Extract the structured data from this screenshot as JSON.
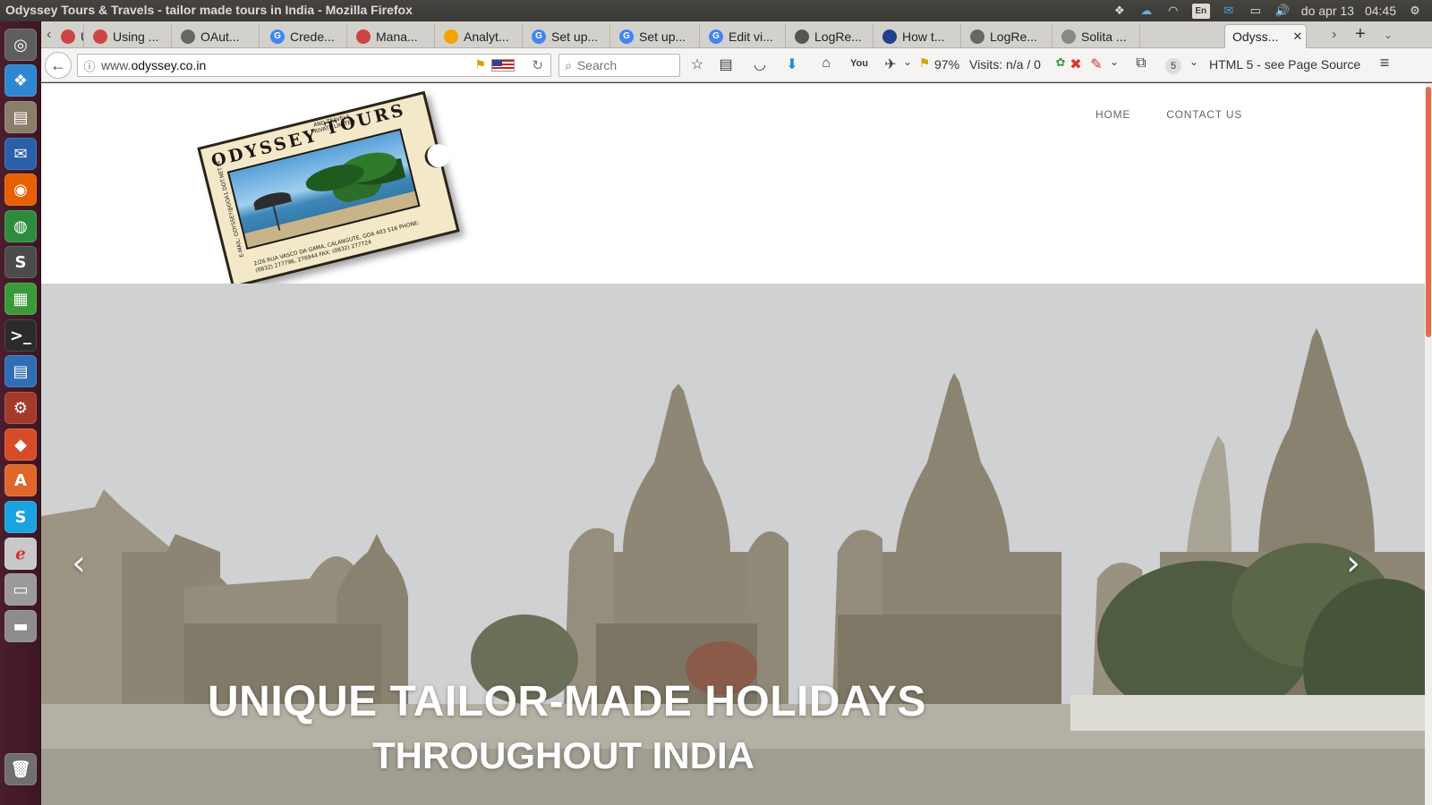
{
  "window": {
    "title": "Odyssey Tours & Travels - tailor made tours in India - Mozilla Firefox"
  },
  "tray": {
    "keyboard": "En",
    "date": "do apr 13",
    "time": "04:45"
  },
  "launcher": {
    "items": [
      {
        "icon": "ubuntu-dash-icon",
        "color": "#5e5e5e",
        "glyph": "◎"
      },
      {
        "icon": "dropbox-icon",
        "color": "#2f86d1",
        "glyph": "❖"
      },
      {
        "icon": "files-icon",
        "color": "#8a7d6a",
        "glyph": "▤"
      },
      {
        "icon": "thunderbird-icon",
        "color": "#2b5fa8",
        "glyph": "✉"
      },
      {
        "icon": "firefox-icon",
        "color": "#e66000",
        "glyph": "◉"
      },
      {
        "icon": "chrome-icon",
        "color": "#2e8b3e",
        "glyph": "◍"
      },
      {
        "icon": "sublime-text-icon",
        "color": "#4b4b4b",
        "glyph": "S"
      },
      {
        "icon": "spreadsheet-icon",
        "color": "#3a9a3a",
        "glyph": "▦"
      },
      {
        "icon": "terminal-icon",
        "color": "#2b2b2b",
        "glyph": ">_"
      },
      {
        "icon": "writer-icon",
        "color": "#2f6db5",
        "glyph": "▤"
      },
      {
        "icon": "settings-icon",
        "color": "#a33a2a",
        "glyph": "⚙"
      },
      {
        "icon": "git-icon",
        "color": "#d84b2a",
        "glyph": "◆"
      },
      {
        "icon": "software-center-icon",
        "color": "#e0672a",
        "glyph": "A"
      },
      {
        "icon": "skype-icon",
        "color": "#1aa3e0",
        "glyph": "S"
      },
      {
        "icon": "pdf-viewer-icon",
        "color": "#c8c8c8",
        "glyph": "ℯ"
      },
      {
        "icon": "scanner-icon",
        "color": "#9a9a9a",
        "glyph": "▭"
      },
      {
        "icon": "drive-icon",
        "color": "#8c8c8c",
        "glyph": "▬"
      },
      {
        "icon": "trash-icon",
        "color": "#6f6f6f",
        "glyph": "🗑"
      }
    ]
  },
  "tabs": [
    {
      "label": "Using ...",
      "icon": "generic-site-icon",
      "color": "#c44"
    },
    {
      "label": "Using ...",
      "icon": "generic-site-icon",
      "color": "#c44"
    },
    {
      "label": "OAut...",
      "icon": "oauth-icon",
      "color": "#666"
    },
    {
      "label": "Crede...",
      "icon": "google-icon",
      "color": "#4285f4"
    },
    {
      "label": "Mana...",
      "icon": "generic-site-icon",
      "color": "#c44"
    },
    {
      "label": "Analyt...",
      "icon": "analytics-icon",
      "color": "#f4a300"
    },
    {
      "label": "Set up...",
      "icon": "google-icon",
      "color": "#4285f4"
    },
    {
      "label": "Set up...",
      "icon": "google-icon",
      "color": "#4285f4"
    },
    {
      "label": "Edit vi...",
      "icon": "google-icon",
      "color": "#4285f4"
    },
    {
      "label": "LogRe...",
      "icon": "generic-site-icon",
      "color": "#555"
    },
    {
      "label": "How t...",
      "icon": "perl-icon",
      "color": "#1f3f8f"
    },
    {
      "label": "LogRe...",
      "icon": "generic-site-icon",
      "color": "#666"
    },
    {
      "label": "Solita ...",
      "icon": "solita-icon",
      "color": "#888"
    },
    {
      "label": "Odyss...",
      "icon": "odyssey-icon",
      "color": "#fff",
      "active": true
    }
  ],
  "navbar": {
    "url_prefix": "www.",
    "url_domain": "odyssey.co.in",
    "search_placeholder": "Search",
    "zoom": "97%",
    "visits": "Visits: n/a / 0",
    "addon_count": "5",
    "html_info": "HTML 5 - see Page Source"
  },
  "site": {
    "nav": {
      "home": "HOME",
      "contact": "CONTACT US"
    },
    "logo": {
      "word1": "ODYSSEY",
      "word2": "TOURS",
      "sub": "AND TRAVELS PRIVATE LIMITED",
      "address": "2/26 RUA VASCO DA GAMA, CALANGUTE, GOA 403 516 PHONE: (0832) 277796, 276944 FAX: (0832) 277724",
      "side": "E-MAIL: ODYSSEY@GOA1.DOT.NET.IN"
    },
    "hero": {
      "line1": "UNIQUE TAILOR-MADE HOLIDAYS",
      "line2": "THROUGHOUT INDIA"
    }
  },
  "colors": {
    "launcher": "#4a1e2c",
    "panel": "#3c3b37",
    "scroll_thumb": "#e0522e"
  }
}
